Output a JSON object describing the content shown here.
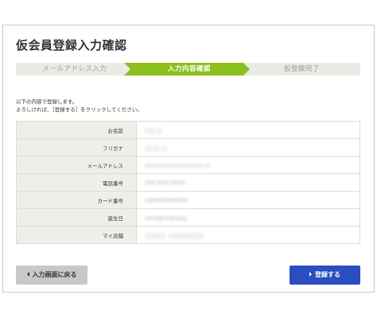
{
  "page": {
    "title": "仮会員登録入力確認"
  },
  "steps": [
    {
      "label": "メールアドレス入力",
      "state": "done"
    },
    {
      "label": "入力内容確認",
      "state": "current"
    },
    {
      "label": "仮登録完了",
      "state": "pending"
    }
  ],
  "colors": {
    "step_active": "#8bbf1e",
    "step_inactive": "#ebebe6",
    "primary_button": "#2a4dbf",
    "secondary_button": "#c8c8c8"
  },
  "intro": {
    "line1": "以下の内容で登録します。",
    "line2": "よろしければ、［登録する］をクリックしてください。"
  },
  "fields": [
    {
      "label": "お名前",
      "value": "〇〇 〇"
    },
    {
      "label": "フリガナ",
      "value": "〇〇〇 〇"
    },
    {
      "label": "メールアドレス",
      "value": "xxxxxxxxxxxxxxxxxxx.xx"
    },
    {
      "label": "電話番号",
      "value": "000-0000-0000"
    },
    {
      "label": "カード番号",
      "value": "0000000000000"
    },
    {
      "label": "誕生日",
      "value": "0000年00月00日"
    },
    {
      "label": "マイ店舗",
      "value": "〇〇〇〇（〇〇〇〇〇〇）"
    }
  ],
  "buttons": {
    "back": "入力画面に戻る",
    "submit": "登録する"
  }
}
